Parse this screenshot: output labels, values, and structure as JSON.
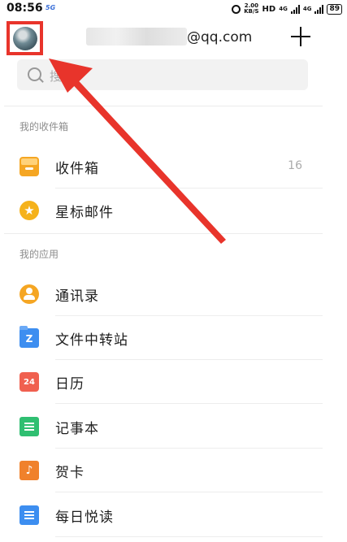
{
  "status_bar": {
    "time": "08:56",
    "network_badge": "5G",
    "speed": "2.00",
    "speed_unit": "KB/S",
    "hd_label": "HD",
    "signal1_label": "4G",
    "signal2_label": "4G",
    "battery": "89",
    "icons": [
      "alarm-icon",
      "signal-icon",
      "battery-icon"
    ]
  },
  "header": {
    "account_suffix": "@qq.com",
    "avatar_highlight_color": "#e8342b",
    "add_icon": "plus-icon"
  },
  "search": {
    "placeholder": "搜索"
  },
  "sections": [
    {
      "title": "我的收件箱",
      "items": [
        {
          "label": "收件箱",
          "count": "16",
          "icon": "inbox-icon"
        },
        {
          "label": "星标邮件",
          "icon": "star-icon"
        }
      ]
    },
    {
      "title": "我的应用",
      "items": [
        {
          "label": "通讯录",
          "icon": "contacts-icon"
        },
        {
          "label": "文件中转站",
          "icon": "folder-icon",
          "badge": "Z"
        },
        {
          "label": "日历",
          "icon": "calendar-icon",
          "badge": "24"
        },
        {
          "label": "记事本",
          "icon": "notepad-icon"
        },
        {
          "label": "贺卡",
          "icon": "card-icon",
          "badge": "♪"
        },
        {
          "label": "每日悦读",
          "icon": "reading-icon"
        }
      ]
    }
  ],
  "annotation": {
    "arrow_color": "#e8342b"
  }
}
